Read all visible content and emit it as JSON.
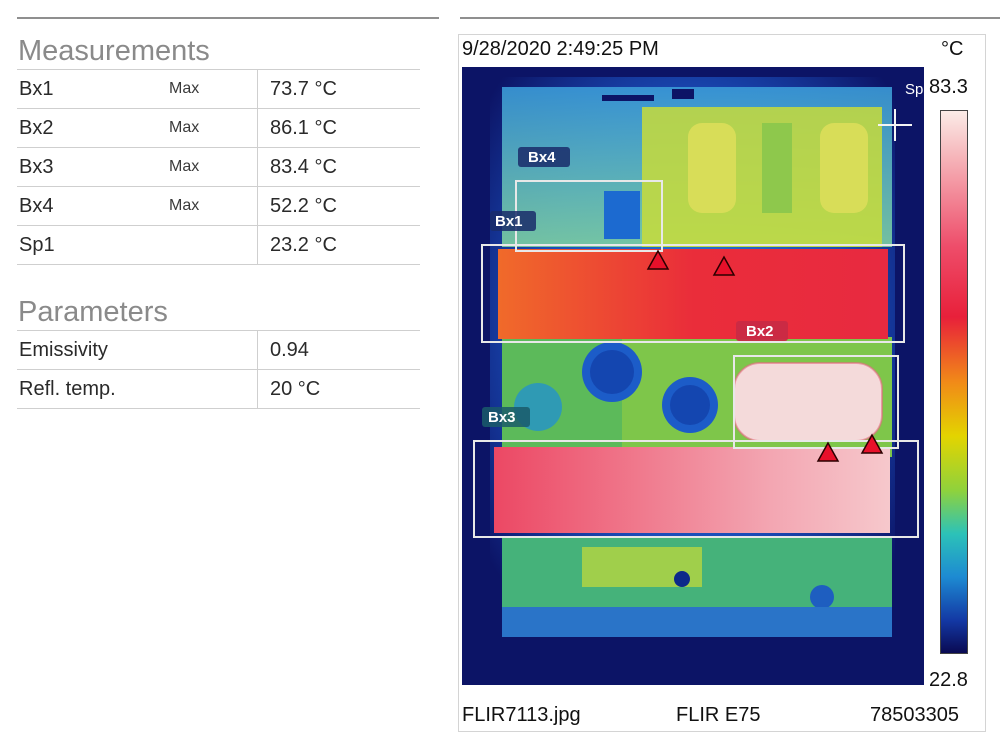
{
  "measurements": {
    "title": "Measurements",
    "rows": [
      {
        "name": "Bx1",
        "type": "Max",
        "value": "73.7 °C"
      },
      {
        "name": "Bx2",
        "type": "Max",
        "value": "86.1 °C"
      },
      {
        "name": "Bx3",
        "type": "Max",
        "value": "83.4 °C"
      },
      {
        "name": "Bx4",
        "type": "Max",
        "value": "52.2 °C"
      },
      {
        "name": "Sp1",
        "type": "",
        "value": "23.2 °C"
      }
    ]
  },
  "parameters": {
    "title": "Parameters",
    "rows": [
      {
        "name": "Emissivity",
        "value": "0.94"
      },
      {
        "name": "Refl. temp.",
        "value": "20  °C"
      }
    ]
  },
  "image": {
    "timestamp": "9/28/2020 2:49:25 PM",
    "unit": "°C",
    "scale_max": "83.3",
    "scale_min": "22.8",
    "filename": "FLIR7113.jpg",
    "camera": "FLIR E75",
    "serial": "78503305",
    "labels": {
      "bx1": "Bx1",
      "bx2": "Bx2",
      "bx3": "Bx3",
      "bx4": "Bx4",
      "sp": "Sp"
    }
  },
  "colors": {
    "hot": "#e8203a",
    "warm": "#f18a18",
    "mid": "#e3d400",
    "cool": "#1d8ad2",
    "cold": "#0a0a52"
  }
}
